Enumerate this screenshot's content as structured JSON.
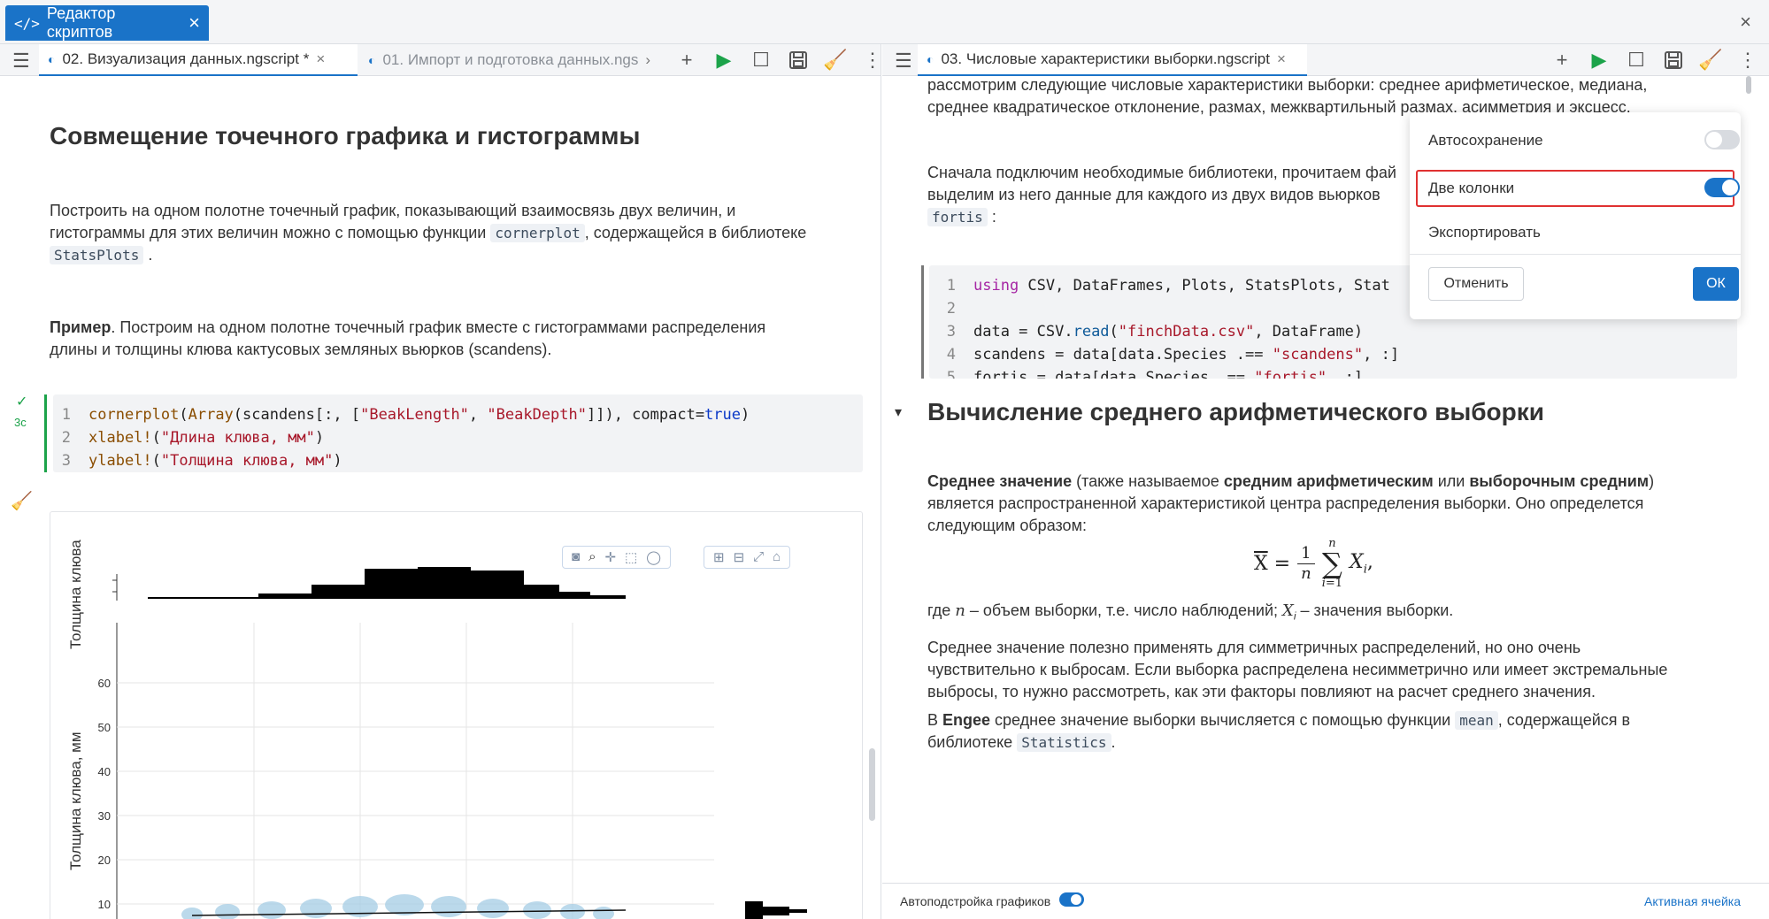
{
  "app": {
    "tab_title": "Редактор скриптов"
  },
  "left": {
    "tabs": [
      {
        "label": "02. Визуализация данных.ngscript *",
        "active": true
      },
      {
        "label": "01. Импорт и подготовка данных.ngs",
        "active": false
      }
    ],
    "heading": "Совмещение точечного графика и гистограммы",
    "para1_a": "Построить на одном полотне точечный график, показывающий взаимосвязь двух величин, и",
    "para1_b": "гистограммы для этих величин можно с помощью функции",
    "para1_code1": "cornerplot",
    "para1_c": ", содержащейся в библиотеке",
    "para1_code2": "StatsPlots",
    "para1_d": ".",
    "para2_bold": "Пример",
    "para2_a": ". Построим на одном полотне точечный график вместе с гистограммами распределения",
    "para2_b": "длины и толщины клюва кактусовых земляных вьюрков (scandens).",
    "cell_time": "3с",
    "code": {
      "l1": {
        "num": "1",
        "fn": "cornerplot",
        "p1": "(",
        "arr": "Array",
        "p2": "(scandens[:, [",
        "s1": "\"BeakLength\"",
        "p3": ", ",
        "s2": "\"BeakDepth\"",
        "p4": "]]), compact=",
        "tr": "true",
        "p5": ")"
      },
      "l2": {
        "num": "2",
        "fn": "xlabel!",
        "p1": "(",
        "s": "\"Длина клюва, мм\"",
        "p2": ")"
      },
      "l3": {
        "num": "3",
        "fn": "ylabel!",
        "p1": "(",
        "s": "\"Толщина клюва, мм\"",
        "p2": ")"
      }
    },
    "plot": {
      "ylabel_top": "Толщина клюва",
      "ylabel_main": "Толщина клюва, мм",
      "yticks": [
        "60",
        "50",
        "40",
        "30",
        "20",
        "10"
      ]
    }
  },
  "right": {
    "tab": "03. Числовые характеристики выборки.ngscript",
    "text_top1": "рассмотрим следующие числовые характеристики выборки: среднее арифметическое, медиана,",
    "text_top2": "среднее квадратическое отклонение, размах, межквартильный размах, асимметрия и эксцесс.",
    "text2_a": "Сначала подключим необходимые библиотеки, прочитаем фай",
    "text2_b": "выделим из него данные для каждого из двух видов вьюрков",
    "text2_code": "fortis",
    "text2_c": ":",
    "code": {
      "l1": {
        "num": "1",
        "kw": "using",
        "rest": " CSV, DataFrames, Plots, StatsPlots, Stat"
      },
      "l2": {
        "num": "2"
      },
      "l3": {
        "num": "3",
        "a": "data = CSV.",
        "fn": "read",
        "b": "(",
        "s": "\"finchData.csv\"",
        "c": ", DataFrame)"
      },
      "l4": {
        "num": "4",
        "a": "scandens = data[data.Species .== ",
        "s": "\"scandens\"",
        "c": ", :]"
      },
      "l5": {
        "num": "5",
        "a": "fortis = data[data.Species .== ",
        "s": "\"fortis\"",
        "c": ", :]"
      }
    },
    "heading": "Вычисление среднего арифметического выборки",
    "mean_b1": "Среднее значение",
    "mean_t1": " (также называемое ",
    "mean_b2": "средним арифметическим",
    "mean_t2": " или ",
    "mean_b3": "выборочным средним",
    "mean_t3": ")",
    "mean_l2": "является распространенной характеристикой центра распределения выборки. Оно определется",
    "mean_l3": "следующим образом:",
    "where_a": "где ",
    "where_n": "n",
    "where_b": " – объем выборки, т.е. число наблюдений; ",
    "where_x": "X",
    "where_i": "i",
    "where_c": " – значения выборки.",
    "para_sym1": "Среднее значение полезно применять для симметричных распределений, но оно очень",
    "para_sym2": "чувствительно к выбросам. Если выборка распределена несимметрично или имеет экстремальные",
    "para_sym3": "выбросы, то нужно рассмотреть, как эти факторы повлияют на расчет среднего значения.",
    "engee_a": "В ",
    "engee_b": "Engee",
    "engee_c": " среднее значение выборки вычисляется с помощью функции",
    "engee_code1": "mean",
    "engee_d": ", содержащейся в",
    "engee_e": "библиотеке",
    "engee_code2": "Statistics",
    "engee_f": "."
  },
  "popup": {
    "autosave": "Автосохранение",
    "two_columns": "Две колонки",
    "export": "Экспортировать",
    "cancel": "Отменить",
    "ok": "ОК"
  },
  "status": {
    "autoplot": "Автоподстройка графиков",
    "active_cell": "Активная ячейка"
  },
  "colors": {
    "accent": "#1a73c8",
    "run": "#1ca34a",
    "highlight": "#e03131"
  }
}
